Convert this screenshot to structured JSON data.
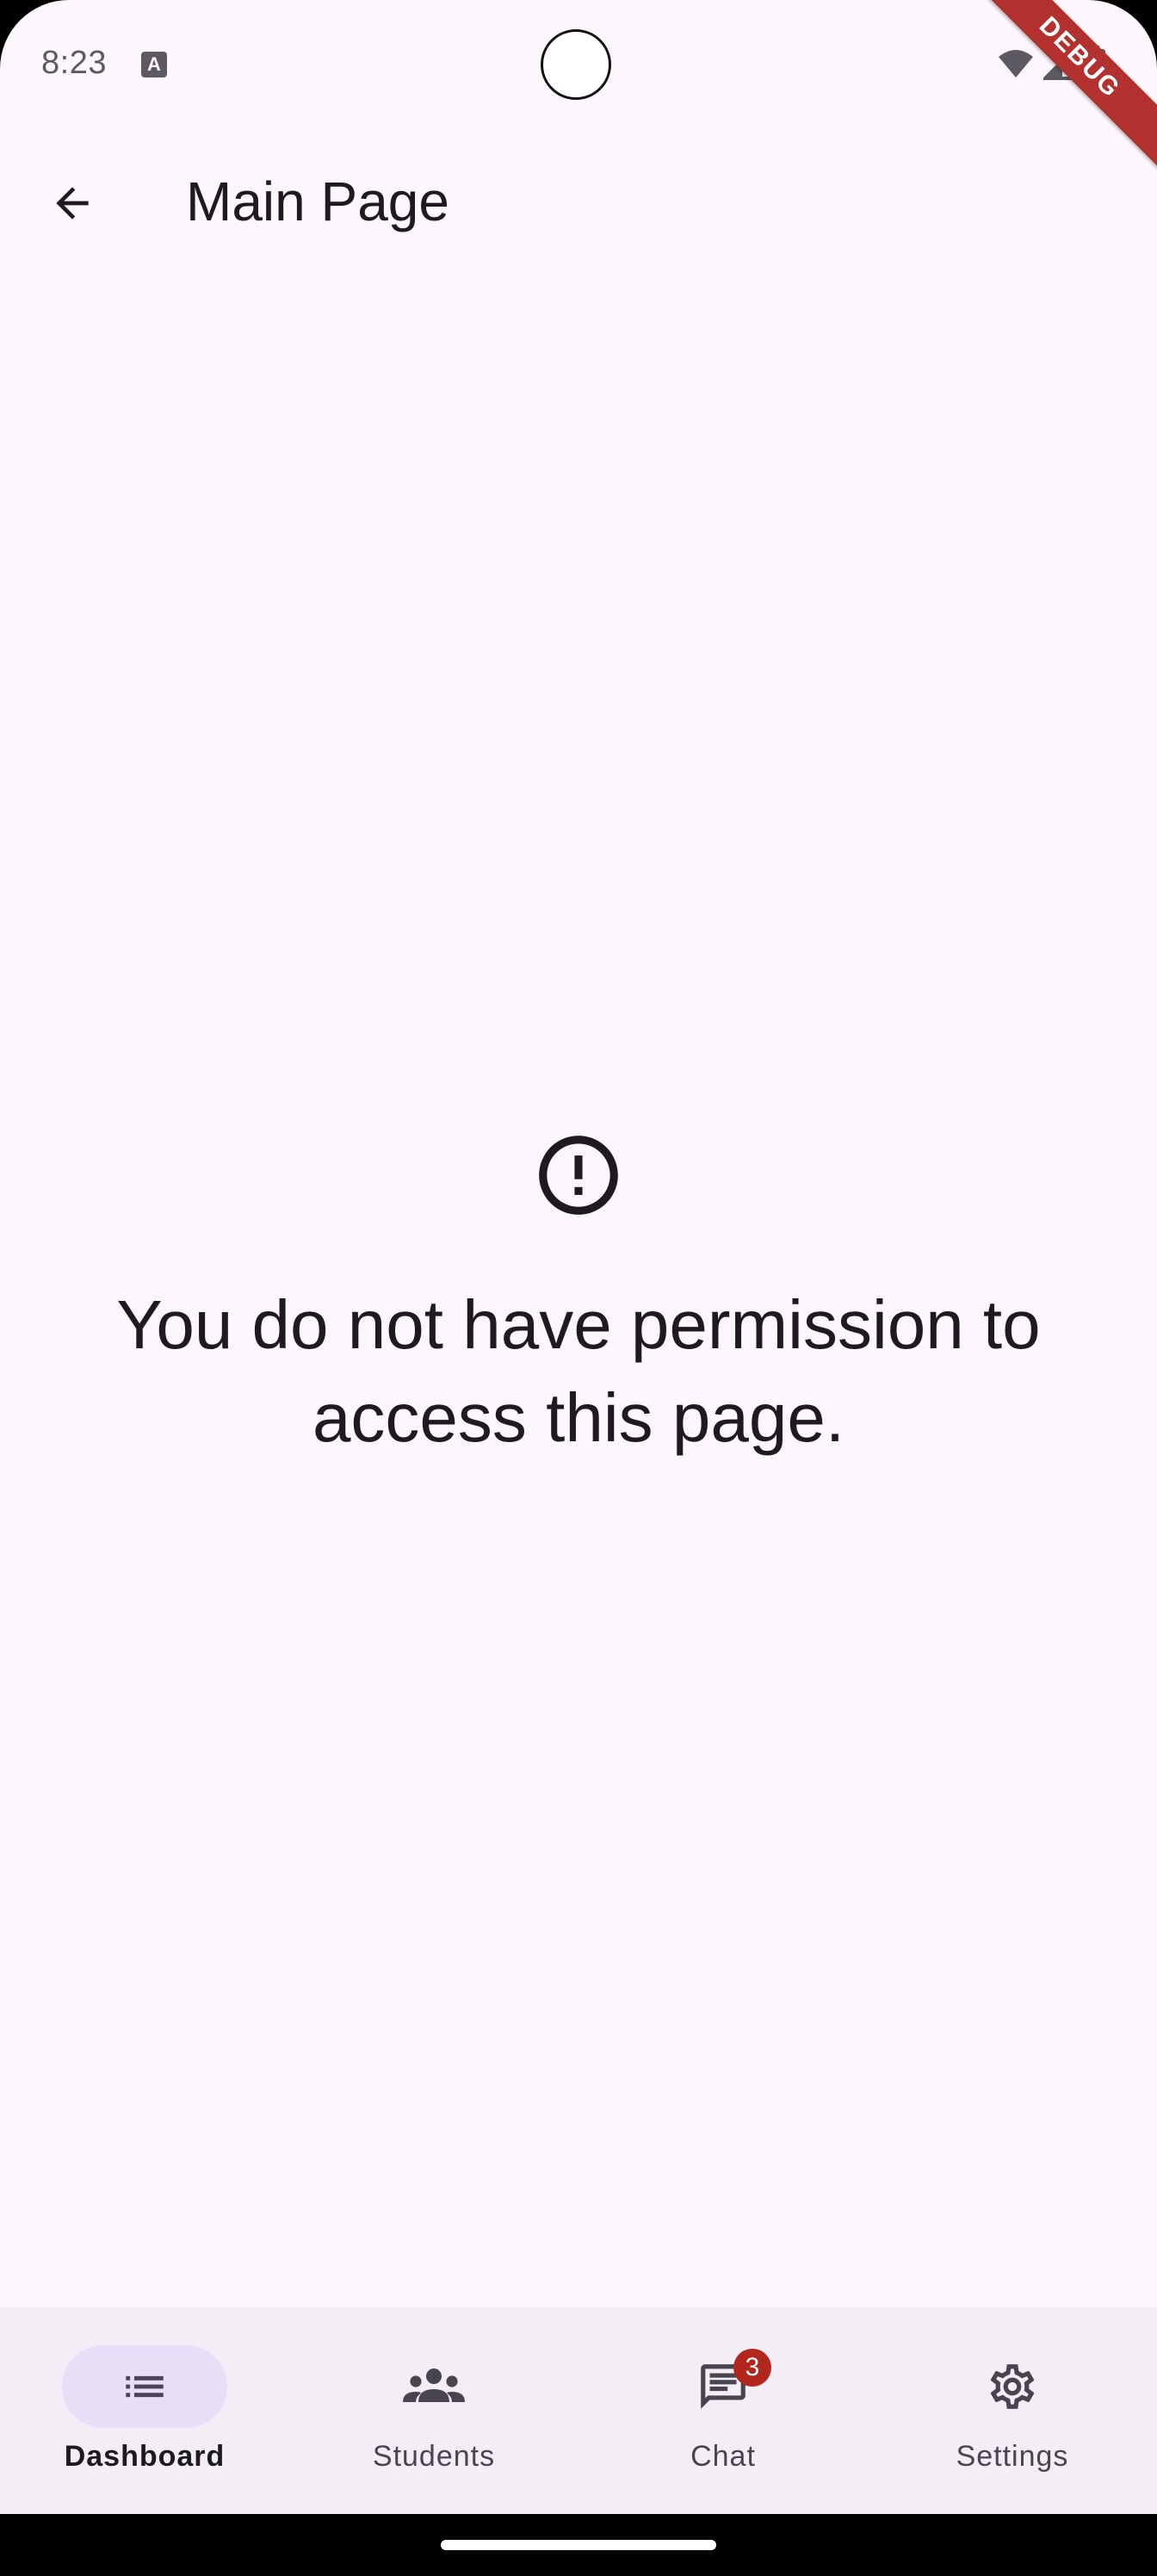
{
  "status_bar": {
    "time": "8:23",
    "notification_icon": "a-icon",
    "notification_glyph": "A",
    "icons": [
      "wifi-icon",
      "signal-icon",
      "battery-icon"
    ]
  },
  "debug_banner": "DEBUG",
  "app_bar": {
    "back_icon": "arrow-back-icon",
    "title": "Main Page"
  },
  "content": {
    "icon": "error-outline-icon",
    "message": "You do not have permission to access this page."
  },
  "bottom_nav": {
    "items": [
      {
        "label": "Dashboard",
        "icon": "list-icon",
        "active": true
      },
      {
        "label": "Students",
        "icon": "groups-icon",
        "active": false
      },
      {
        "label": "Chat",
        "icon": "chat-icon",
        "active": false,
        "badge": "3"
      },
      {
        "label": "Settings",
        "icon": "gear-icon",
        "active": false
      }
    ]
  },
  "colors": {
    "background": "#fdf7fd",
    "nav_background": "#f3edf6",
    "active_indicator": "#e8def8",
    "badge": "#b3261e",
    "debug_ribbon": "#b3312f"
  }
}
